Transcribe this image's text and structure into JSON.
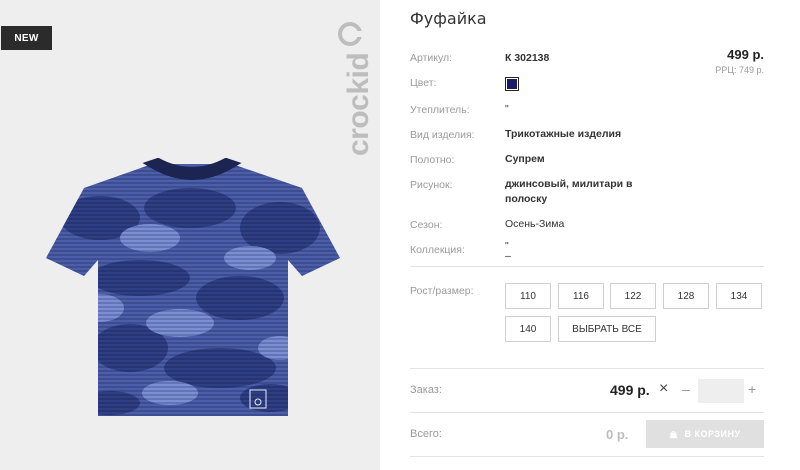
{
  "product": {
    "badge": "NEW",
    "brand": "crockid",
    "title": "Фуфайка"
  },
  "details": [
    {
      "label": "Артикул:",
      "value": "К 302138"
    },
    {
      "label": "Цвет:",
      "value": ""
    },
    {
      "label": "Утеплитель:",
      "value": "\""
    },
    {
      "label": "Вид изделия:",
      "value": "Трикотажные изделия"
    },
    {
      "label": "Полотно:",
      "value": "Супрем"
    },
    {
      "label": "Рисунок:",
      "value_line1": "джинсовый, милитари в",
      "value_line2": "полоску"
    },
    {
      "label": "Сезон:",
      "value": "Осень-Зима"
    },
    {
      "label": "Коллекция:",
      "value_line1": "\"",
      "value_line2": "–"
    }
  ],
  "price": {
    "current": "499 р.",
    "rrp_label": "РРЦ:",
    "rrp_value": "749 р."
  },
  "colors": {
    "swatch": "#1a1a66",
    "camo_dark": "#2f3f86",
    "camo_mid": "#4a5eaa",
    "camo_light": "#7b8fd6",
    "collar": "#1c2552"
  },
  "sizes": {
    "label": "Рост/размер:",
    "options": [
      "110",
      "116",
      "122",
      "128",
      "134",
      "140"
    ],
    "select_all": "ВЫБРАТЬ ВСЕ"
  },
  "order": {
    "label": "Заказ:",
    "price": "499 р.",
    "clear_icon": "×",
    "minus": "–",
    "plus": "+",
    "quantity": ""
  },
  "total": {
    "label": "Всего:",
    "value": "0 р.",
    "cart_button": "В КОРЗИНУ"
  }
}
